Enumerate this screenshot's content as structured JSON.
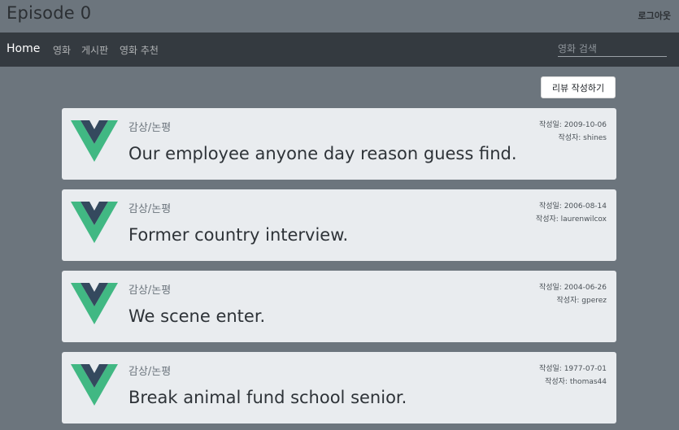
{
  "app": {
    "title": "Episode 0",
    "logout_label": "로그아웃"
  },
  "nav": {
    "home_label": "Home",
    "links": [
      "영화",
      "게시판",
      "영화 추천"
    ],
    "search_placeholder": "영화 검색"
  },
  "actions": {
    "write_review_label": "리뷰 작성하기"
  },
  "labels": {
    "date_prefix": "작성일: ",
    "author_prefix": "작성자: "
  },
  "colors": {
    "vue_green": "#41b883",
    "vue_dark": "#34495e"
  },
  "reviews": [
    {
      "category": "감상/논평",
      "title": "Our employee anyone day reason guess find.",
      "date": "2009-10-06",
      "author": "shines"
    },
    {
      "category": "감상/논평",
      "title": "Former country interview.",
      "date": "2006-08-14",
      "author": "laurenwilcox"
    },
    {
      "category": "감상/논평",
      "title": "We scene enter.",
      "date": "2004-06-26",
      "author": "gperez"
    },
    {
      "category": "감상/논평",
      "title": "Break animal fund school senior.",
      "date": "1977-07-01",
      "author": "thomas44"
    }
  ]
}
